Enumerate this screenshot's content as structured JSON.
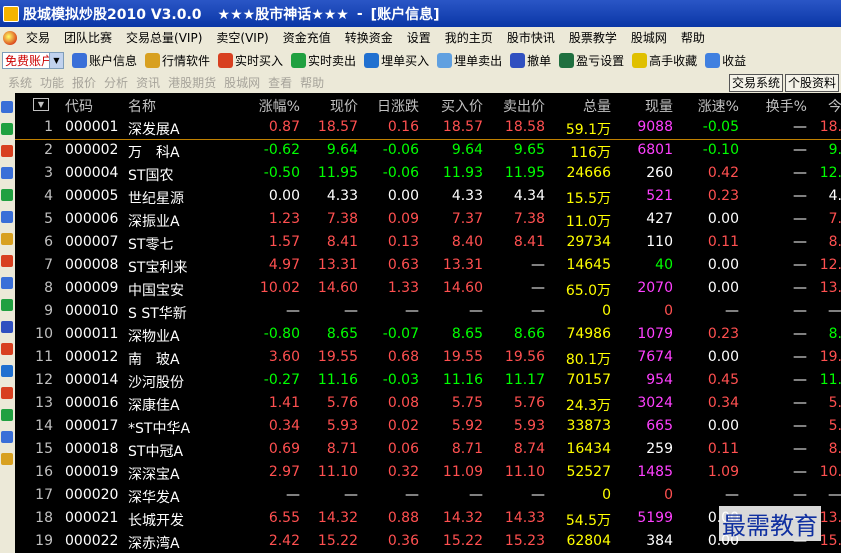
{
  "window": {
    "title": "股城模拟炒股2010 V3.0.0",
    "slogan": "★★★股市神话★★★",
    "separator": "-",
    "section": "[账户信息]"
  },
  "menu": [
    "交易",
    "团队比赛",
    "交易总量(VIP)",
    "卖空(VIP)",
    "资金充值",
    "转换资金",
    "设置",
    "我的主页",
    "股市快讯",
    "股票教学",
    "股城网",
    "帮助"
  ],
  "toolbar": {
    "account_select": "免费账户",
    "buttons": [
      {
        "label": "账户信息",
        "icon": "account-icon",
        "color": "#3a6fd8"
      },
      {
        "label": "行情软件",
        "icon": "chart-icon",
        "color": "#d8a020"
      },
      {
        "label": "实时买入",
        "icon": "buy-icon",
        "color": "#d84020"
      },
      {
        "label": "实时卖出",
        "icon": "sell-icon",
        "color": "#20a040"
      },
      {
        "label": "埋单买入",
        "icon": "order-buy-icon",
        "color": "#2070d0"
      },
      {
        "label": "埋单卖出",
        "icon": "order-sell-icon",
        "color": "#60a0e0"
      },
      {
        "label": "撤单",
        "icon": "cancel-order-icon",
        "color": "#3050c0"
      },
      {
        "label": "盈亏设置",
        "icon": "profit-settings-icon",
        "color": "#207040"
      },
      {
        "label": "高手收藏",
        "icon": "favorites-icon",
        "color": "#e0c000"
      },
      {
        "label": "收益",
        "icon": "earnings-icon",
        "color": "#4080e0"
      }
    ]
  },
  "toolbar2": {
    "items": [
      "系统",
      "功能",
      "报价",
      "分析",
      "资讯",
      "港股期货",
      "股城网",
      "查看",
      "帮助"
    ],
    "buttons": [
      "交易系统",
      "个股资料"
    ]
  },
  "table": {
    "columns": [
      "代码",
      "名称",
      "涨幅%",
      "现价",
      "日涨跌",
      "买入价",
      "卖出价",
      "总量",
      "现量",
      "涨速%",
      "换手%",
      "今"
    ],
    "rows": [
      {
        "n": "1",
        "code": "000001",
        "name": "深发展A",
        "chg_pct": "0.87",
        "price": "18.57",
        "chg": "0.16",
        "bid": "18.57",
        "ask": "18.58",
        "vol": "59.1万",
        "cur_vol": "9088",
        "speed": "-0.05",
        "turnover": "—",
        "open": "18.",
        "dir": "up",
        "cv": "mg"
      },
      {
        "n": "2",
        "code": "000002",
        "name": "万　科A",
        "chg_pct": "-0.62",
        "price": "9.64",
        "chg": "-0.06",
        "bid": "9.64",
        "ask": "9.65",
        "vol": "116万",
        "cur_vol": "6801",
        "speed": "-0.10",
        "turnover": "—",
        "open": "9.",
        "dir": "dn",
        "cv": "mg"
      },
      {
        "n": "3",
        "code": "000004",
        "name": "ST国农",
        "chg_pct": "-0.50",
        "price": "11.95",
        "chg": "-0.06",
        "bid": "11.93",
        "ask": "11.95",
        "vol": "24666",
        "cur_vol": "260",
        "speed": "0.42",
        "turnover": "—",
        "open": "12.",
        "dir": "dn",
        "cv": "wh"
      },
      {
        "n": "4",
        "code": "000005",
        "name": "世纪星源",
        "chg_pct": "0.00",
        "price": "4.33",
        "chg": "0.00",
        "bid": "4.33",
        "ask": "4.34",
        "vol": "15.5万",
        "cur_vol": "521",
        "speed": "0.23",
        "turnover": "—",
        "open": "4.",
        "dir": "fl",
        "cv": "mg"
      },
      {
        "n": "5",
        "code": "000006",
        "name": "深振业A",
        "chg_pct": "1.23",
        "price": "7.38",
        "chg": "0.09",
        "bid": "7.37",
        "ask": "7.38",
        "vol": "11.0万",
        "cur_vol": "427",
        "speed": "0.00",
        "turnover": "—",
        "open": "7.",
        "dir": "up",
        "cv": "wh"
      },
      {
        "n": "6",
        "code": "000007",
        "name": "ST零七",
        "chg_pct": "1.57",
        "price": "8.41",
        "chg": "0.13",
        "bid": "8.40",
        "ask": "8.41",
        "vol": "29734",
        "cur_vol": "110",
        "speed": "0.11",
        "turnover": "—",
        "open": "8.",
        "dir": "up",
        "cv": "wh"
      },
      {
        "n": "7",
        "code": "000008",
        "name": "ST宝利来",
        "chg_pct": "4.97",
        "price": "13.31",
        "chg": "0.63",
        "bid": "13.31",
        "ask": "—",
        "vol": "14645",
        "cur_vol": "40",
        "speed": "0.00",
        "turnover": "—",
        "open": "12.",
        "dir": "up",
        "cv": "dn"
      },
      {
        "n": "8",
        "code": "000009",
        "name": "中国宝安",
        "chg_pct": "10.02",
        "price": "14.60",
        "chg": "1.33",
        "bid": "14.60",
        "ask": "—",
        "vol": "65.0万",
        "cur_vol": "2070",
        "speed": "0.00",
        "turnover": "—",
        "open": "13.",
        "dir": "up",
        "cv": "mg"
      },
      {
        "n": "9",
        "code": "000010",
        "name": "S ST华新",
        "chg_pct": "—",
        "price": "—",
        "chg": "—",
        "bid": "—",
        "ask": "—",
        "vol": "0",
        "cur_vol": "0",
        "speed": "—",
        "turnover": "—",
        "open": "—",
        "dir": "fl",
        "cv": "up"
      },
      {
        "n": "10",
        "code": "000011",
        "name": "深物业A",
        "chg_pct": "-0.80",
        "price": "8.65",
        "chg": "-0.07",
        "bid": "8.65",
        "ask": "8.66",
        "vol": "74986",
        "cur_vol": "1079",
        "speed": "0.23",
        "turnover": "—",
        "open": "8.",
        "dir": "dn",
        "cv": "mg"
      },
      {
        "n": "11",
        "code": "000012",
        "name": "南　玻A",
        "chg_pct": "3.60",
        "price": "19.55",
        "chg": "0.68",
        "bid": "19.55",
        "ask": "19.56",
        "vol": "80.1万",
        "cur_vol": "7674",
        "speed": "0.00",
        "turnover": "—",
        "open": "19.",
        "dir": "up",
        "cv": "mg"
      },
      {
        "n": "12",
        "code": "000014",
        "name": "沙河股份",
        "chg_pct": "-0.27",
        "price": "11.16",
        "chg": "-0.03",
        "bid": "11.16",
        "ask": "11.17",
        "vol": "70157",
        "cur_vol": "954",
        "speed": "0.45",
        "turnover": "—",
        "open": "11.",
        "dir": "dn",
        "cv": "mg"
      },
      {
        "n": "13",
        "code": "000016",
        "name": "深康佳A",
        "chg_pct": "1.41",
        "price": "5.76",
        "chg": "0.08",
        "bid": "5.75",
        "ask": "5.76",
        "vol": "24.3万",
        "cur_vol": "3024",
        "speed": "0.34",
        "turnover": "—",
        "open": "5.",
        "dir": "up",
        "cv": "mg"
      },
      {
        "n": "14",
        "code": "000017",
        "name": "*ST中华A",
        "chg_pct": "0.34",
        "price": "5.93",
        "chg": "0.02",
        "bid": "5.92",
        "ask": "5.93",
        "vol": "33873",
        "cur_vol": "665",
        "speed": "0.00",
        "turnover": "—",
        "open": "5.",
        "dir": "up",
        "cv": "mg"
      },
      {
        "n": "15",
        "code": "000018",
        "name": "ST中冠A",
        "chg_pct": "0.69",
        "price": "8.71",
        "chg": "0.06",
        "bid": "8.71",
        "ask": "8.74",
        "vol": "16434",
        "cur_vol": "259",
        "speed": "0.11",
        "turnover": "—",
        "open": "8.",
        "dir": "up",
        "cv": "wh"
      },
      {
        "n": "16",
        "code": "000019",
        "name": "深深宝A",
        "chg_pct": "2.97",
        "price": "11.10",
        "chg": "0.32",
        "bid": "11.09",
        "ask": "11.10",
        "vol": "52527",
        "cur_vol": "1485",
        "speed": "1.09",
        "turnover": "—",
        "open": "10.",
        "dir": "up",
        "cv": "mg"
      },
      {
        "n": "17",
        "code": "000020",
        "name": "深华发A",
        "chg_pct": "—",
        "price": "—",
        "chg": "—",
        "bid": "—",
        "ask": "—",
        "vol": "0",
        "cur_vol": "0",
        "speed": "—",
        "turnover": "—",
        "open": "—",
        "dir": "fl",
        "cv": "up"
      },
      {
        "n": "18",
        "code": "000021",
        "name": "长城开发",
        "chg_pct": "6.55",
        "price": "14.32",
        "chg": "0.88",
        "bid": "14.32",
        "ask": "14.33",
        "vol": "54.5万",
        "cur_vol": "5199",
        "speed": "0.00",
        "turnover": "—",
        "open": "13.",
        "dir": "up",
        "cv": "mg"
      },
      {
        "n": "19",
        "code": "000022",
        "name": "深赤湾A",
        "chg_pct": "2.42",
        "price": "15.22",
        "chg": "0.36",
        "bid": "15.22",
        "ask": "15.23",
        "vol": "62804",
        "cur_vol": "384",
        "speed": "0.00",
        "turnover": "—",
        "open": "15.",
        "dir": "up",
        "cv": "wh"
      }
    ]
  },
  "watermark": "最需教育",
  "colors": {
    "up": "#ff5050",
    "down": "#00ff00",
    "flat": "#ffffff",
    "volume": "#ffff00",
    "big_volume": "#ff40ff",
    "background": "#000000"
  }
}
